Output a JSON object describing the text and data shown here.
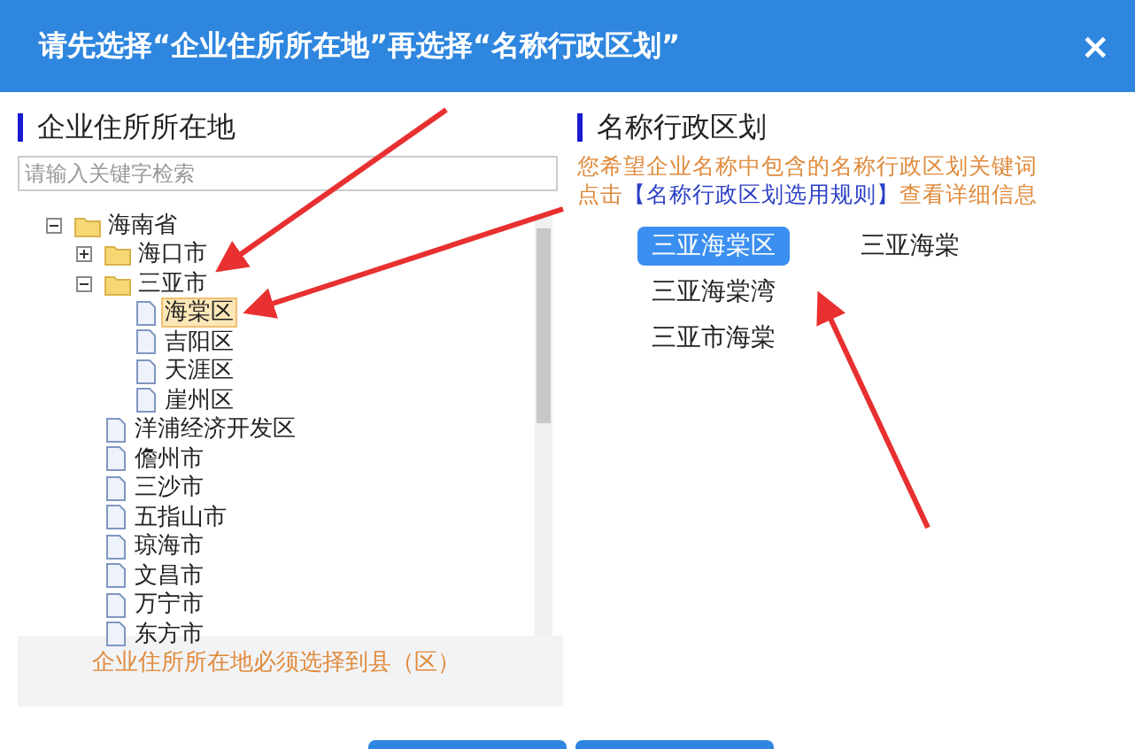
{
  "dialog": {
    "title": "请先选择“企业住所所在地”再选择“名称行政区划”",
    "close": "×"
  },
  "left_panel": {
    "heading": "企业住所所在地",
    "search": {
      "placeholder": "请输入关键字检索"
    },
    "tree": [
      {
        "label": "海南省",
        "kind": "folder",
        "expanded": true,
        "selected": false,
        "children": [
          {
            "label": "海口市",
            "kind": "folder",
            "expanded": false,
            "selected": false
          },
          {
            "label": "三亚市",
            "kind": "folder",
            "expanded": true,
            "selected": false,
            "children": [
              {
                "label": "海棠区",
                "kind": "leaf",
                "selected": true
              },
              {
                "label": "吉阳区",
                "kind": "leaf",
                "selected": false
              },
              {
                "label": "天涯区",
                "kind": "leaf",
                "selected": false
              },
              {
                "label": "崖州区",
                "kind": "leaf",
                "selected": false
              }
            ]
          },
          {
            "label": "洋浦经济开发区",
            "kind": "leaf",
            "selected": false
          },
          {
            "label": "儋州市",
            "kind": "leaf",
            "selected": false
          },
          {
            "label": "三沙市",
            "kind": "leaf",
            "selected": false
          },
          {
            "label": "五指山市",
            "kind": "leaf",
            "selected": false
          },
          {
            "label": "琼海市",
            "kind": "leaf",
            "selected": false
          },
          {
            "label": "文昌市",
            "kind": "leaf",
            "selected": false
          },
          {
            "label": "万宁市",
            "kind": "leaf",
            "selected": false
          },
          {
            "label": "东方市",
            "kind": "leaf",
            "selected": false
          }
        ]
      }
    ],
    "notice": "企业住所所在地必须选择到县（区）"
  },
  "right_panel": {
    "heading": "名称行政区划",
    "hint": "您希望企业名称中包含的名称行政区划关键词",
    "rule_prefix": "点击",
    "rule_link": "【名称行政区划选用规则】",
    "rule_suffix": "查看详细信息",
    "options": [
      {
        "label": "三亚海棠区",
        "selected": true
      },
      {
        "label": "三亚海棠",
        "selected": false
      },
      {
        "label": "三亚海棠湾",
        "selected": false
      },
      {
        "label": "三亚市海棠",
        "selected": false
      }
    ]
  }
}
